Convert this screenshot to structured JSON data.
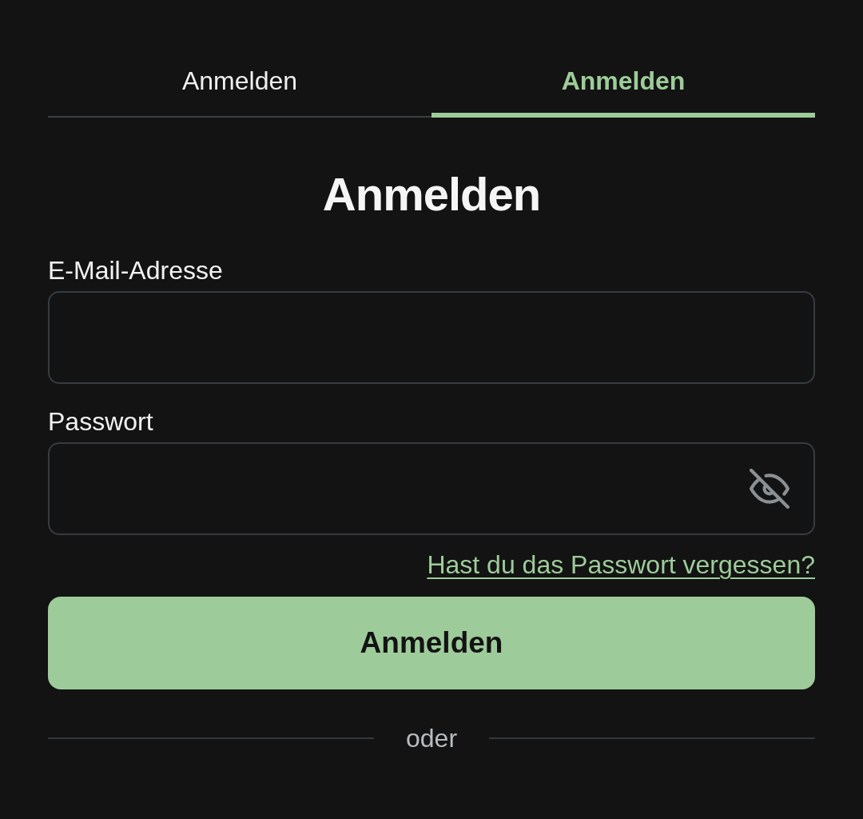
{
  "tabs": [
    {
      "label": "Anmelden",
      "selected": false
    },
    {
      "label": "Anmelden",
      "selected": true
    }
  ],
  "heading": "Anmelden",
  "fields": [
    {
      "kind": "email",
      "label": "E-Mail-Adresse"
    },
    {
      "kind": "password",
      "label": "Passwort",
      "password_visible": false
    }
  ],
  "forgot_link": "Hast du das Passwort vergessen?",
  "submit_button": "Anmelden",
  "divider": "oder"
}
